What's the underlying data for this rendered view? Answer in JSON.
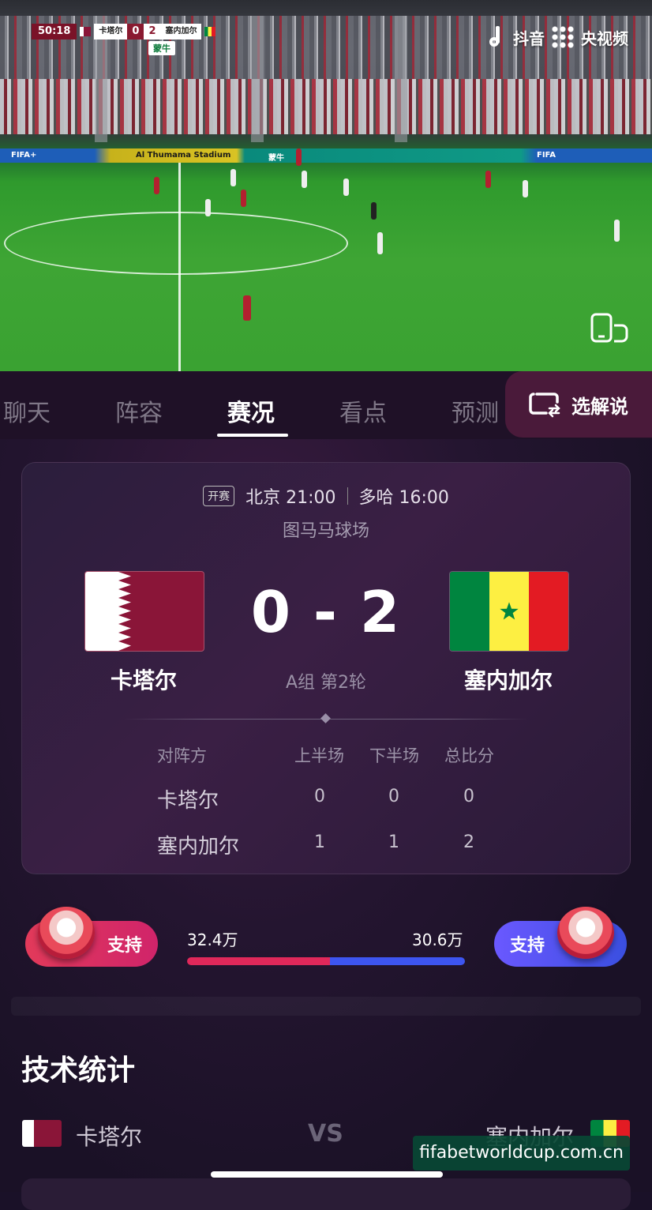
{
  "video": {
    "scoreboard": {
      "time": "50:18",
      "home_team": "卡塔尔",
      "home_score": "0",
      "away_score": "2",
      "away_team": "塞内加尔"
    },
    "sponsor": "蒙牛",
    "stadium_board": "Al Thumama Stadium",
    "brand_douyin": "抖音",
    "brand_cctv": "央视频",
    "ad_fifa": "FIFA+",
    "ad_mengniu": "蒙牛",
    "ad_fifa2": "FIFA"
  },
  "tabs": [
    "聊天",
    "阵容",
    "赛况",
    "看点",
    "预测"
  ],
  "active_tab": "赛况",
  "commentary_label": "选解说",
  "match": {
    "kickoff_badge": "开赛",
    "beijing_time": "北京 21:00",
    "doha_time": "多哈 16:00",
    "venue": "图马马球场",
    "score_text": "0 - 2",
    "home_name": "卡塔尔",
    "away_name": "塞内加尔",
    "round": "A组 第2轮"
  },
  "score_table": {
    "headers": [
      "对阵方",
      "上半场",
      "下半场",
      "总比分"
    ],
    "rows": [
      {
        "team": "卡塔尔",
        "first_half": "0",
        "second_half": "0",
        "total": "0"
      },
      {
        "team": "塞内加尔",
        "first_half": "1",
        "second_half": "1",
        "total": "2"
      }
    ]
  },
  "support": {
    "home_label": "支持",
    "away_label": "支持",
    "home_votes": "32.4万",
    "away_votes": "30.6万",
    "home_votes_value": 324000,
    "away_votes_value": 306000
  },
  "stats": {
    "title": "技术统计",
    "home": "卡塔尔",
    "vs": "VS",
    "away": "塞内加尔"
  },
  "watermark": "fifabetworldcup.com.cn",
  "colors": {
    "qatar_maroon": "#8a1538",
    "senegal_green": "#00853f",
    "senegal_yellow": "#fdef42",
    "senegal_red": "#e31b23",
    "home_support": "#e0285a",
    "away_support": "#3d55f0"
  }
}
